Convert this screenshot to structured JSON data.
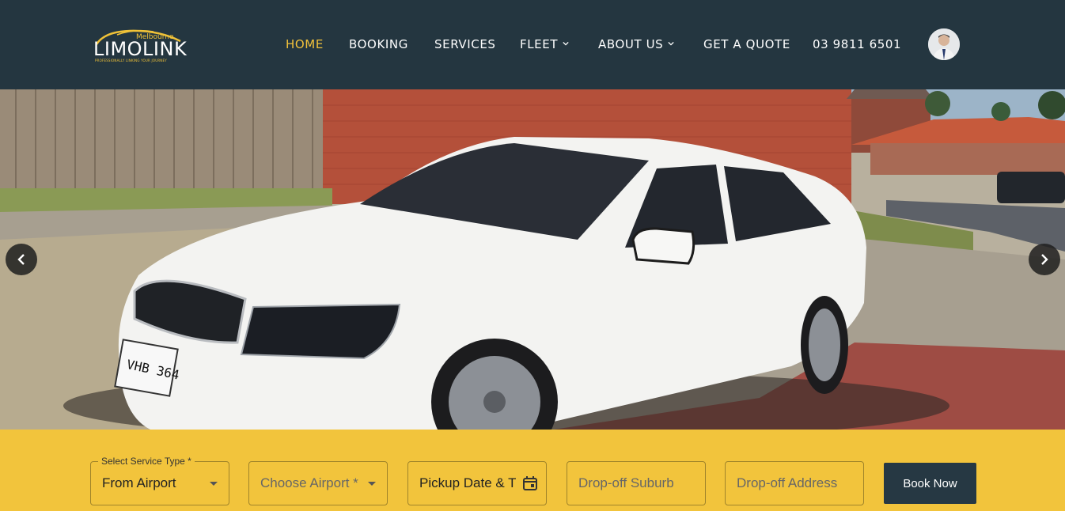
{
  "header": {
    "logo": {
      "top_text": "Melbourne",
      "main_text": "LIMOLINK",
      "tagline": "PROFESSIONALLY LINKING YOUR JOURNEY"
    },
    "nav": [
      {
        "label": "HOME",
        "active": true
      },
      {
        "label": "BOOKING"
      },
      {
        "label": "SERVICES"
      },
      {
        "label": "FLEET",
        "dropdown": true
      },
      {
        "label": "ABOUT US",
        "dropdown": true
      },
      {
        "label": "GET A QUOTE"
      },
      {
        "label": "03 9811 6501"
      }
    ]
  },
  "hero": {
    "plate_text": "VHB 364",
    "prev_icon": "chevron-left-icon",
    "next_icon": "chevron-right-icon"
  },
  "booking": {
    "service_type_label": "Select Service Type *",
    "service_type_value": "From Airport",
    "airport_placeholder": "Choose Airport *",
    "pickup_placeholder": "Pickup Date & Time",
    "dropoff_suburb_placeholder": "Drop-off Suburb",
    "dropoff_address_placeholder": "Drop-off Address",
    "book_button": "Book Now"
  },
  "colors": {
    "header_bg": "#243640",
    "accent": "#f2c23b",
    "booking_bg": "#f2c43c",
    "button_bg": "#263843"
  }
}
